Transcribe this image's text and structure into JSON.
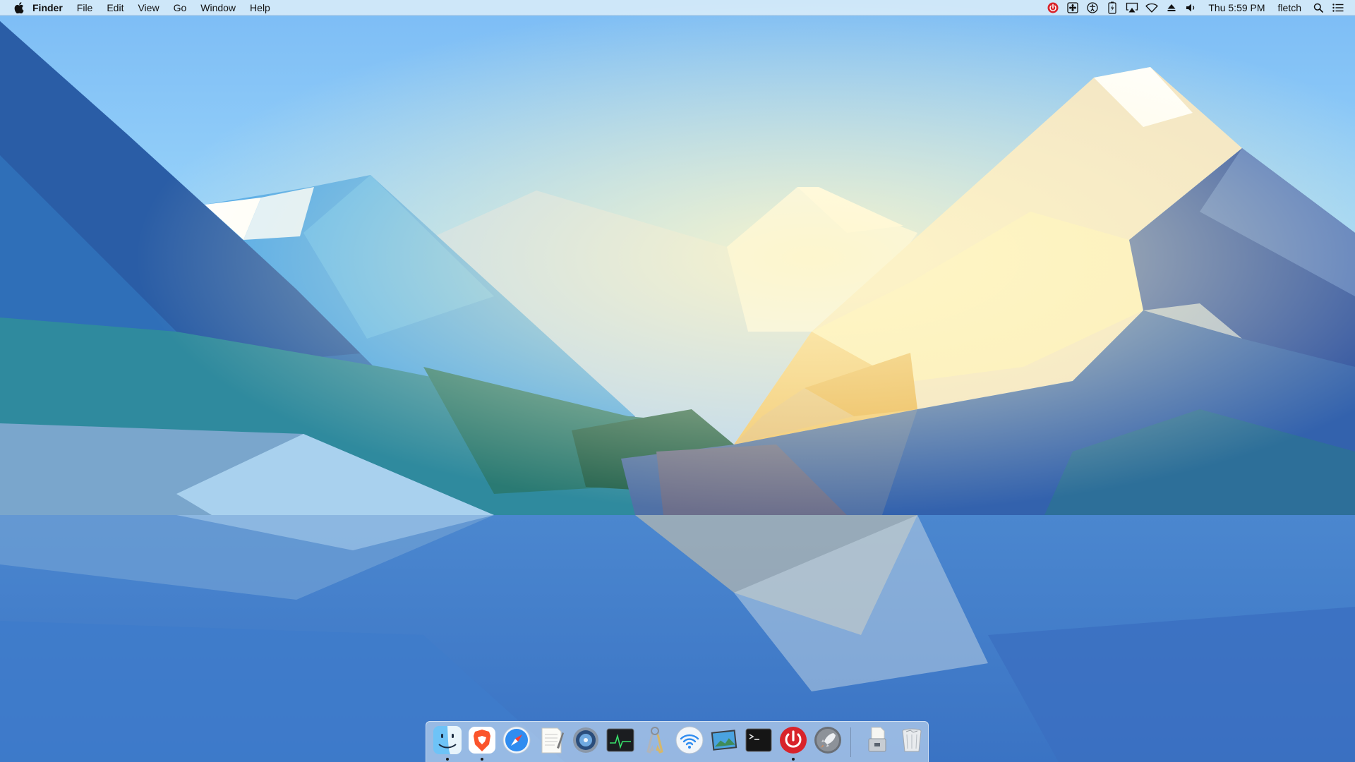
{
  "menubar": {
    "app_name": "Finder",
    "menus": [
      "File",
      "Edit",
      "View",
      "Go",
      "Window",
      "Help"
    ],
    "clock": "Thu 5:59 PM",
    "user": "fletch",
    "status_icons": [
      "power-icon",
      "fan-icon",
      "accessibility-icon",
      "battery-charging-icon",
      "airplay-icon",
      "wifi-icon",
      "eject-icon",
      "volume-icon"
    ]
  },
  "dock": {
    "apps": [
      {
        "name": "Finder",
        "icon": "finder-icon",
        "running": true
      },
      {
        "name": "Brave Browser",
        "icon": "brave-icon",
        "running": true
      },
      {
        "name": "Safari",
        "icon": "safari-icon",
        "running": false
      },
      {
        "name": "TextEdit",
        "icon": "textedit-icon",
        "running": false
      },
      {
        "name": "Disk Utility",
        "icon": "disk-utility-icon",
        "running": false
      },
      {
        "name": "Activity Monitor",
        "icon": "activity-monitor-icon",
        "running": false
      },
      {
        "name": "Keychain Access",
        "icon": "keychain-icon",
        "running": false
      },
      {
        "name": "Wireless Diagnostics",
        "icon": "wifi-diagnostics-icon",
        "running": false
      },
      {
        "name": "Preview",
        "icon": "preview-icon",
        "running": false
      },
      {
        "name": "Terminal",
        "icon": "terminal-icon",
        "running": false
      },
      {
        "name": "Power Off",
        "icon": "power-button-icon",
        "running": true
      },
      {
        "name": "Launchpad",
        "icon": "launchpad-icon",
        "running": false
      }
    ],
    "extras": [
      {
        "name": "Downloads",
        "icon": "downloads-stack-icon"
      },
      {
        "name": "Trash",
        "icon": "trash-icon"
      }
    ]
  },
  "colors": {
    "sky_top": "#7cbcf5",
    "water": "#3d7cc9",
    "accent_red": "#d8232a"
  }
}
